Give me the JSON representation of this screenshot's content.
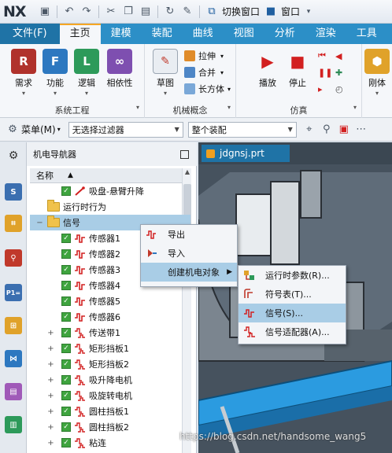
{
  "app": {
    "logo": "NX",
    "quick_access": {
      "switch_window": "切换窗口",
      "window": "窗口"
    }
  },
  "tabs": [
    {
      "label": "文件(F)"
    },
    {
      "label": "主页"
    },
    {
      "label": "建模"
    },
    {
      "label": "装配"
    },
    {
      "label": "曲线"
    },
    {
      "label": "视图"
    },
    {
      "label": "分析"
    },
    {
      "label": "渲染"
    },
    {
      "label": "工具"
    }
  ],
  "ribbon": {
    "system_engineering": {
      "label": "系统工程",
      "buttons": [
        "需求",
        "功能",
        "逻辑",
        "相依性"
      ]
    },
    "mechanical_concept": {
      "label": "机械概念",
      "sketch": "草图",
      "small": [
        "拉伸",
        "合并",
        "长方体"
      ]
    },
    "simulation": {
      "label": "仿真",
      "play": "播放",
      "stop": "停止"
    },
    "rigid": "刚体"
  },
  "filterbar": {
    "menu": "菜单(M)",
    "filter": "无选择过滤器",
    "assembly": "整个装配"
  },
  "navigator": {
    "title": "机电导航器",
    "column": "名称",
    "rows": [
      {
        "label": "吸盘-悬臂升降",
        "kind": "sig-red"
      },
      {
        "label": "运行时行为",
        "kind": "folder"
      },
      {
        "label": "信号",
        "kind": "folder"
      },
      {
        "label": "传感器1",
        "kind": "signal"
      },
      {
        "label": "传感器2",
        "kind": "signal"
      },
      {
        "label": "传感器3",
        "kind": "signal"
      },
      {
        "label": "传感器4",
        "kind": "signal"
      },
      {
        "label": "传感器5",
        "kind": "signal"
      },
      {
        "label": "传感器6",
        "kind": "signal"
      },
      {
        "label": "传送带1",
        "kind": "signal"
      },
      {
        "label": "矩形挡板1",
        "kind": "signal"
      },
      {
        "label": "矩形挡板2",
        "kind": "signal"
      },
      {
        "label": "吸升降电机",
        "kind": "signal"
      },
      {
        "label": "吸旋转电机",
        "kind": "signal"
      },
      {
        "label": "圆柱挡板1",
        "kind": "signal"
      },
      {
        "label": "圆柱挡板2",
        "kind": "signal"
      },
      {
        "label": "粘连",
        "kind": "signal"
      }
    ]
  },
  "graphics": {
    "tab": "jdgnsj.prt"
  },
  "context_menu": {
    "items": [
      "导出",
      "导入",
      "创建机电对象"
    ]
  },
  "submenu": {
    "items": [
      "运行时参数(R)...",
      "符号表(T)...",
      "信号(S)...",
      "信号适配器(A)..."
    ]
  },
  "watermark": "https://blog.csdn.net/handsome_wang5",
  "colors": {
    "tab_bar": "#2c8fc7",
    "file_tab": "#1f73a6",
    "selection": "#a9cde6",
    "signal_icon": "#d22020"
  }
}
